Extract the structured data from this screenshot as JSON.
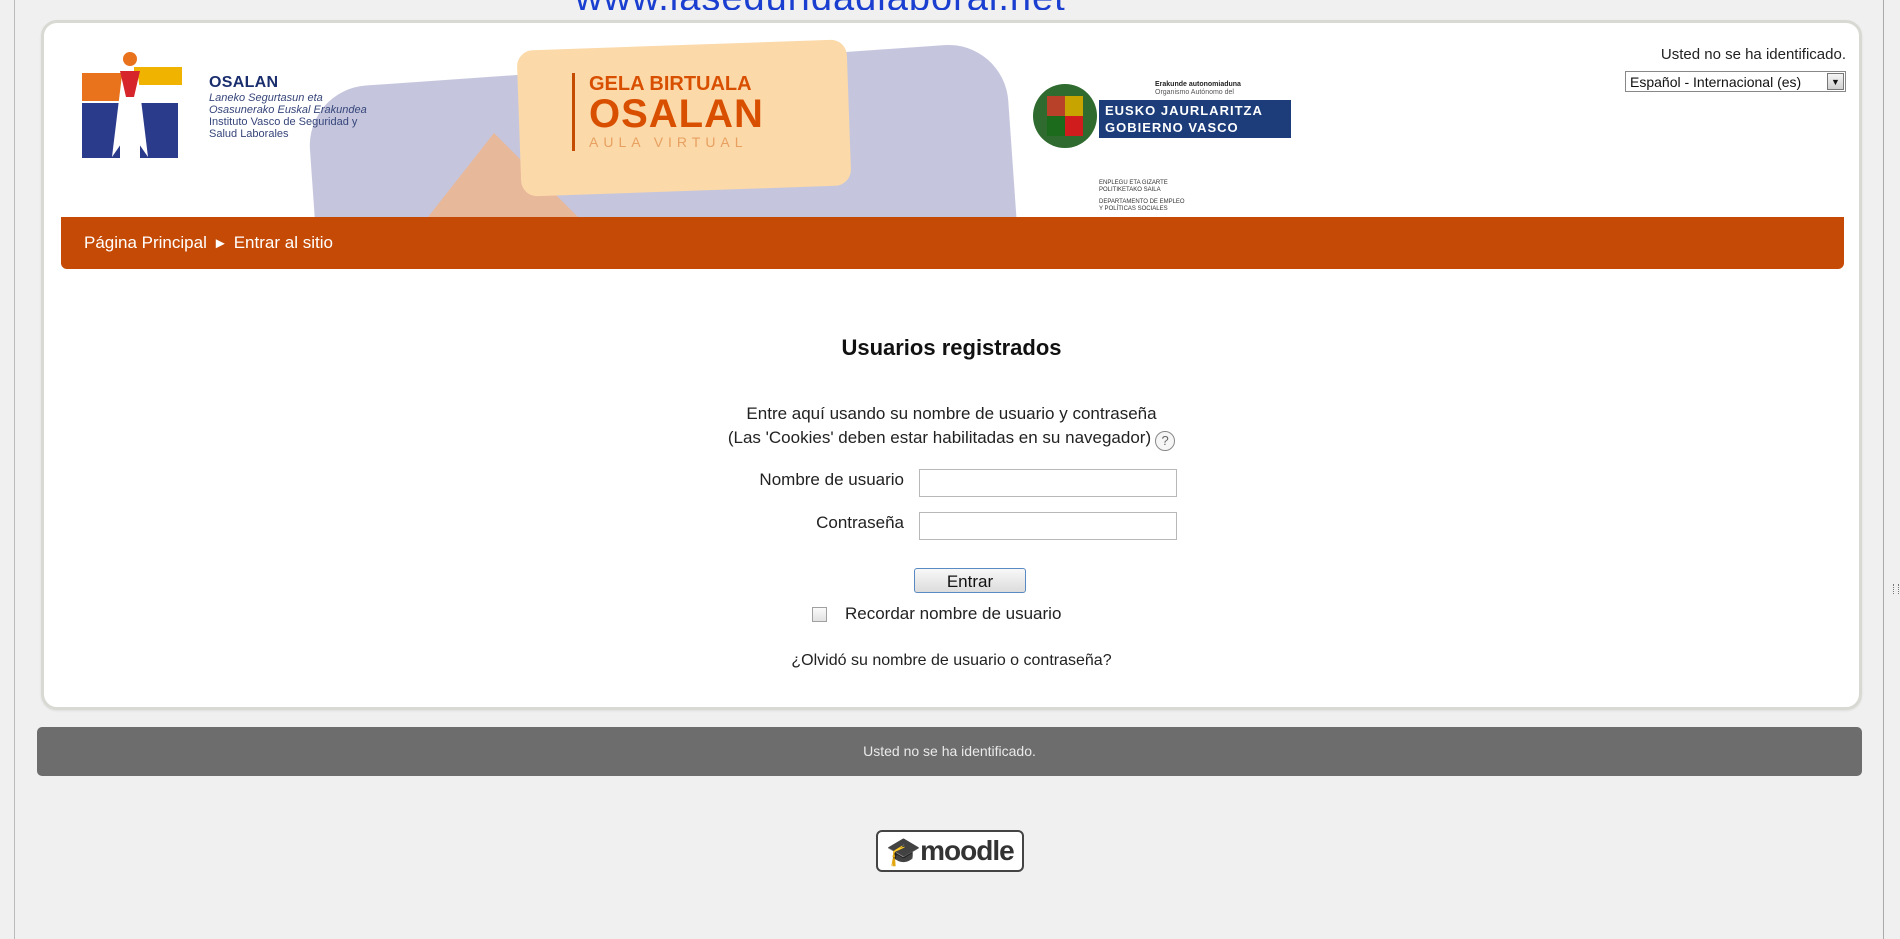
{
  "top_link": "www.laseguridadlaboral.net",
  "header": {
    "osalan": {
      "title": "OSALAN",
      "line1": "Laneko Segurtasun eta",
      "line2": "Osasunerako Euskal Erakundea",
      "line3": "Instituto Vasco de Seguridad y",
      "line4": "Salud Laborales"
    },
    "gela": {
      "line1": "GELA BIRTUALA",
      "line2": "OSALAN",
      "line3": "AULA VIRTUAL"
    },
    "gobierno": {
      "small1": "Erakunde autonomiaduna",
      "small2": "Organismo Autónomo del",
      "banner1": "EUSKO JAURLARITZA",
      "banner2": "GOBIERNO VASCO",
      "dept1": "ENPLEGU ETA GIZARTE",
      "dept2": "POLITIKETAKO SAILA",
      "dept3": "DEPARTAMENTO DE EMPLEO",
      "dept4": "Y POLÍTICAS SOCIALES"
    },
    "login_status": "Usted no se ha identificado.",
    "language": "Español - Internacional (es)"
  },
  "breadcrumb": {
    "home": "Página Principal",
    "separator": "►",
    "current": "Entrar al sitio"
  },
  "login": {
    "heading": "Usuarios registrados",
    "desc_line1": "Entre aquí usando su nombre de usuario y contraseña",
    "desc_line2": "(Las 'Cookies' deben estar habilitadas en su navegador)",
    "help_symbol": "?",
    "username_label": "Nombre de usuario",
    "username_value": "",
    "password_label": "Contraseña",
    "password_value": "",
    "submit_label": "Entrar",
    "remember_label": "Recordar nombre de usuario",
    "forgot_link": "¿Olvidó su nombre de usuario o contraseña?"
  },
  "footer": {
    "status": "Usted no se ha identificado.",
    "moodle_logo_text": "moodle"
  },
  "colors": {
    "navbar": "#c54a05",
    "footer": "#6d6d6d",
    "link": "#1a3fd0"
  }
}
